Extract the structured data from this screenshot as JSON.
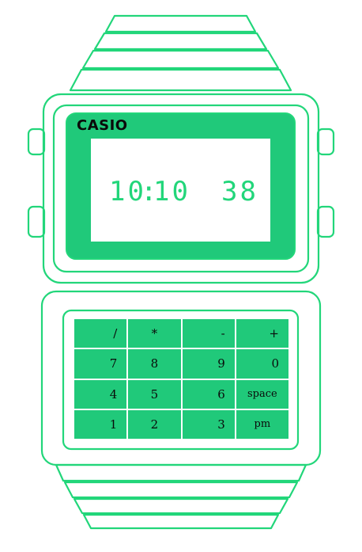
{
  "watch": {
    "brand": "CASIO",
    "colors": {
      "outline": "#22d67a",
      "screen_bezel": "#20c97a",
      "digits": "#22d67a",
      "key_fill": "#20c97a"
    },
    "display": {
      "hours": "10",
      "separator": ":",
      "minutes": "10",
      "seconds": "38"
    },
    "keypad": {
      "rows": [
        [
          "/",
          "*",
          "-",
          "+"
        ],
        [
          "7",
          "8",
          "9",
          "0"
        ],
        [
          "4",
          "5",
          "6",
          "space"
        ],
        [
          "1",
          "2",
          "3",
          "pm"
        ]
      ]
    }
  }
}
